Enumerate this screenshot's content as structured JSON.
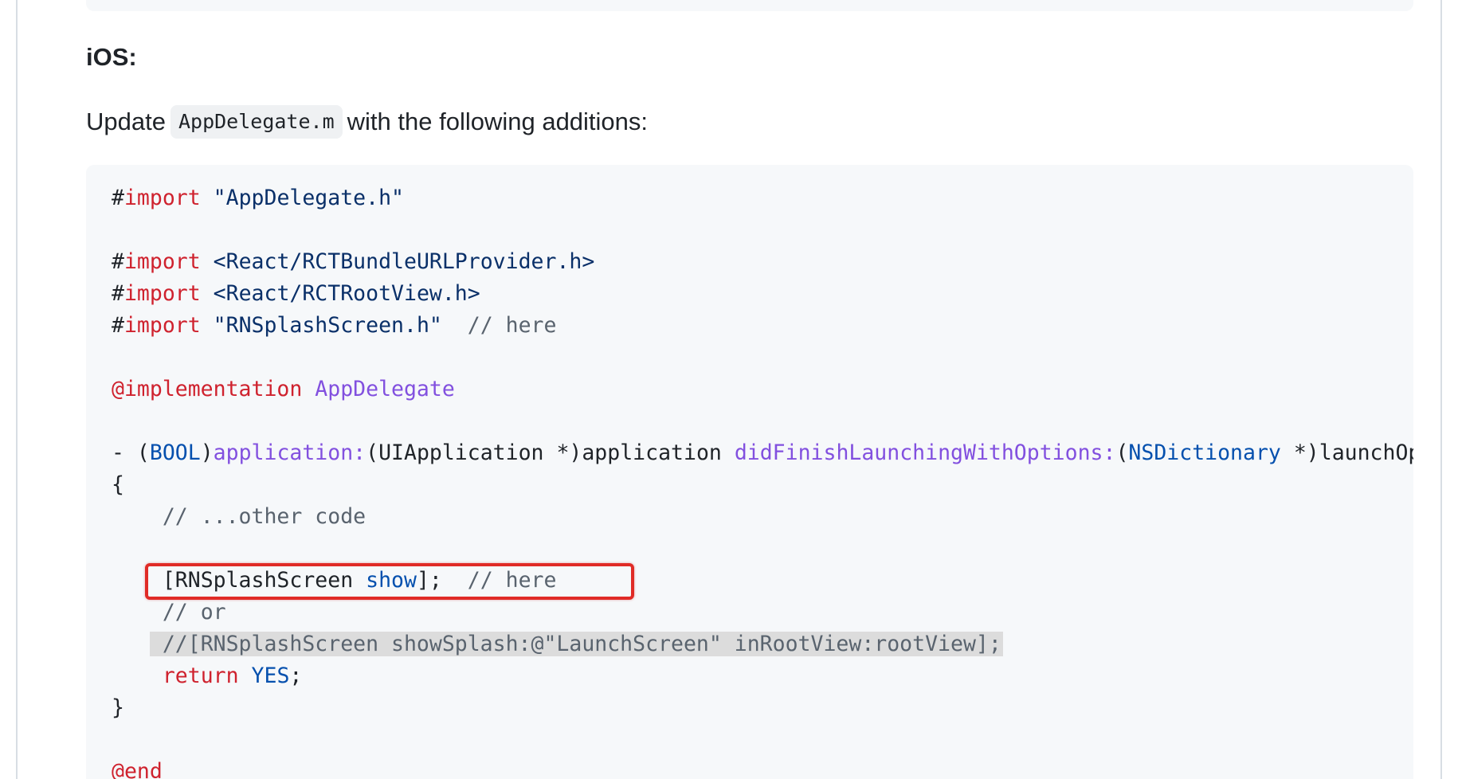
{
  "heading": "iOS:",
  "intro": {
    "before": "Update",
    "file": "AppDelegate.m",
    "after": "with the following additions:"
  },
  "code": {
    "import_hash": "#",
    "import_kw": "import",
    "line1_str": "\"AppDelegate.h\"",
    "line3_str": "<React/RCTBundleURLProvider.h>",
    "line4_str": "<React/RCTRootView.h>",
    "line5_str": "\"RNSplashScreen.h\"",
    "line5_cmt": "// here",
    "impl_kw": "@implementation",
    "impl_name": "AppDelegate",
    "method_dash": "- (",
    "method_type": "BOOL",
    "method_close": ")",
    "method_sel1": "application:",
    "method_arg1": "(UIApplication *)application ",
    "method_sel2": "didFinishLaunchingWithOptions:",
    "method_open2": "(",
    "method_type2": "NSDictionary",
    "method_arg2": " *)launchOptions",
    "open_brace": "{",
    "other_code": "// ...other code",
    "show_open": "[RNSplashScreen ",
    "show_sel": "show",
    "show_close": "];",
    "show_cmt": "// here",
    "or_cmt": "// or",
    "alt_cmt": "//[RNSplashScreen showSplash:@\"LaunchScreen\" inRootView:rootView];",
    "return_kw": "return",
    "return_val": "YES",
    "semicolon": ";",
    "close_brace": "}",
    "end_kw": "@end"
  },
  "colors": {
    "callout": "#e02b26",
    "keyword": "#cf222e",
    "string": "#0a3069",
    "comment": "#59636e",
    "function": "#8250df",
    "type": "#0550ae"
  }
}
